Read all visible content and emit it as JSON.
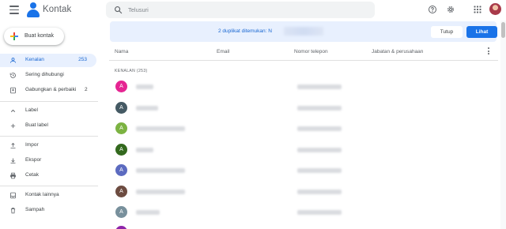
{
  "header": {
    "app_title": "Kontak",
    "search_placeholder": "Telusuri"
  },
  "sidebar": {
    "create_label": "Buat kontak",
    "items": [
      {
        "label": "Kenalan",
        "count": "253",
        "icon": "person-icon",
        "active": true
      },
      {
        "label": "Sering dihubungi",
        "count": "",
        "icon": "history-icon"
      },
      {
        "label": "Gabungkan & perbaiki",
        "count": "2",
        "icon": "merge-icon"
      },
      {
        "label": "Label",
        "count": "",
        "icon": "chevron-up-icon"
      },
      {
        "label": "Buat label",
        "count": "",
        "icon": "plus-icon"
      },
      {
        "label": "Impor",
        "count": "",
        "icon": "upload-icon"
      },
      {
        "label": "Ekspor",
        "count": "",
        "icon": "download-icon"
      },
      {
        "label": "Cetak",
        "count": "",
        "icon": "printer-icon"
      },
      {
        "label": "Kontak lainnya",
        "count": "",
        "icon": "archive-icon"
      },
      {
        "label": "Sampah",
        "count": "",
        "icon": "trash-icon"
      }
    ]
  },
  "banner": {
    "message": "2 duplikat ditemukan: N",
    "dismiss_label": "Tutup",
    "view_label": "Lihat"
  },
  "table": {
    "columns": [
      "Nama",
      "Email",
      "Nomor telepon",
      "Jabatan & perusahaan"
    ],
    "section_label": "KENALAN (253)",
    "rows": [
      {
        "initial": "A",
        "color": "#e52592"
      },
      {
        "initial": "A",
        "color": "#455a64"
      },
      {
        "initial": "A",
        "color": "#7cb342"
      },
      {
        "initial": "A",
        "color": "#33691e"
      },
      {
        "initial": "A",
        "color": "#5c6bc0"
      },
      {
        "initial": "A",
        "color": "#6d4c41"
      },
      {
        "initial": "A",
        "color": "#78909c"
      }
    ]
  },
  "colors": {
    "accent": "#1a73e8",
    "active_bg": "#e8f0fe",
    "banner_text": "#1967d2"
  }
}
